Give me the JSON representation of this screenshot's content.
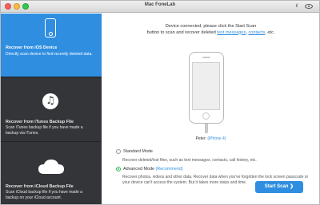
{
  "window": {
    "title": "Mac FoneLab"
  },
  "sidebar": {
    "items": [
      {
        "title": "Recover from iOS Device",
        "desc": "Directly scan device to find recently deleted data."
      },
      {
        "title": "Recover from iTunes Backup File",
        "desc": "Scan iTunes backup file if you have made a backup via iTunes."
      },
      {
        "title": "Recover from iCloud Backup File",
        "desc": "Scan iCloud backup file if you have made a backup on your iCloud account."
      }
    ]
  },
  "main": {
    "info_line1": "Device connected, please click the Start Scan",
    "info_line2_pre": "button to scan and recover deleted ",
    "info_link1": "text messages",
    "info_sep": ", ",
    "info_link2": "contacts",
    "info_post": ", etc.",
    "device_label": "Peter",
    "device_model": "(iPhone 4)",
    "standard_mode": {
      "label": "Standard Mode",
      "desc": "Recover deleted/lost files, such as text messages, contacts, call history, etc."
    },
    "advanced_mode": {
      "label": "Advanced Mode",
      "recommend": "(Recommend)",
      "desc": "Recover photos, videos and other data. Recover data when you've forgotten the lock screen passcode or your device can't access the system. But it takes more steps and time."
    },
    "start_button": "Start Scan"
  },
  "colors": {
    "accent": "#2f8ee0",
    "sidebar_bg": "#333538",
    "radio_on": "#2fb84f"
  }
}
